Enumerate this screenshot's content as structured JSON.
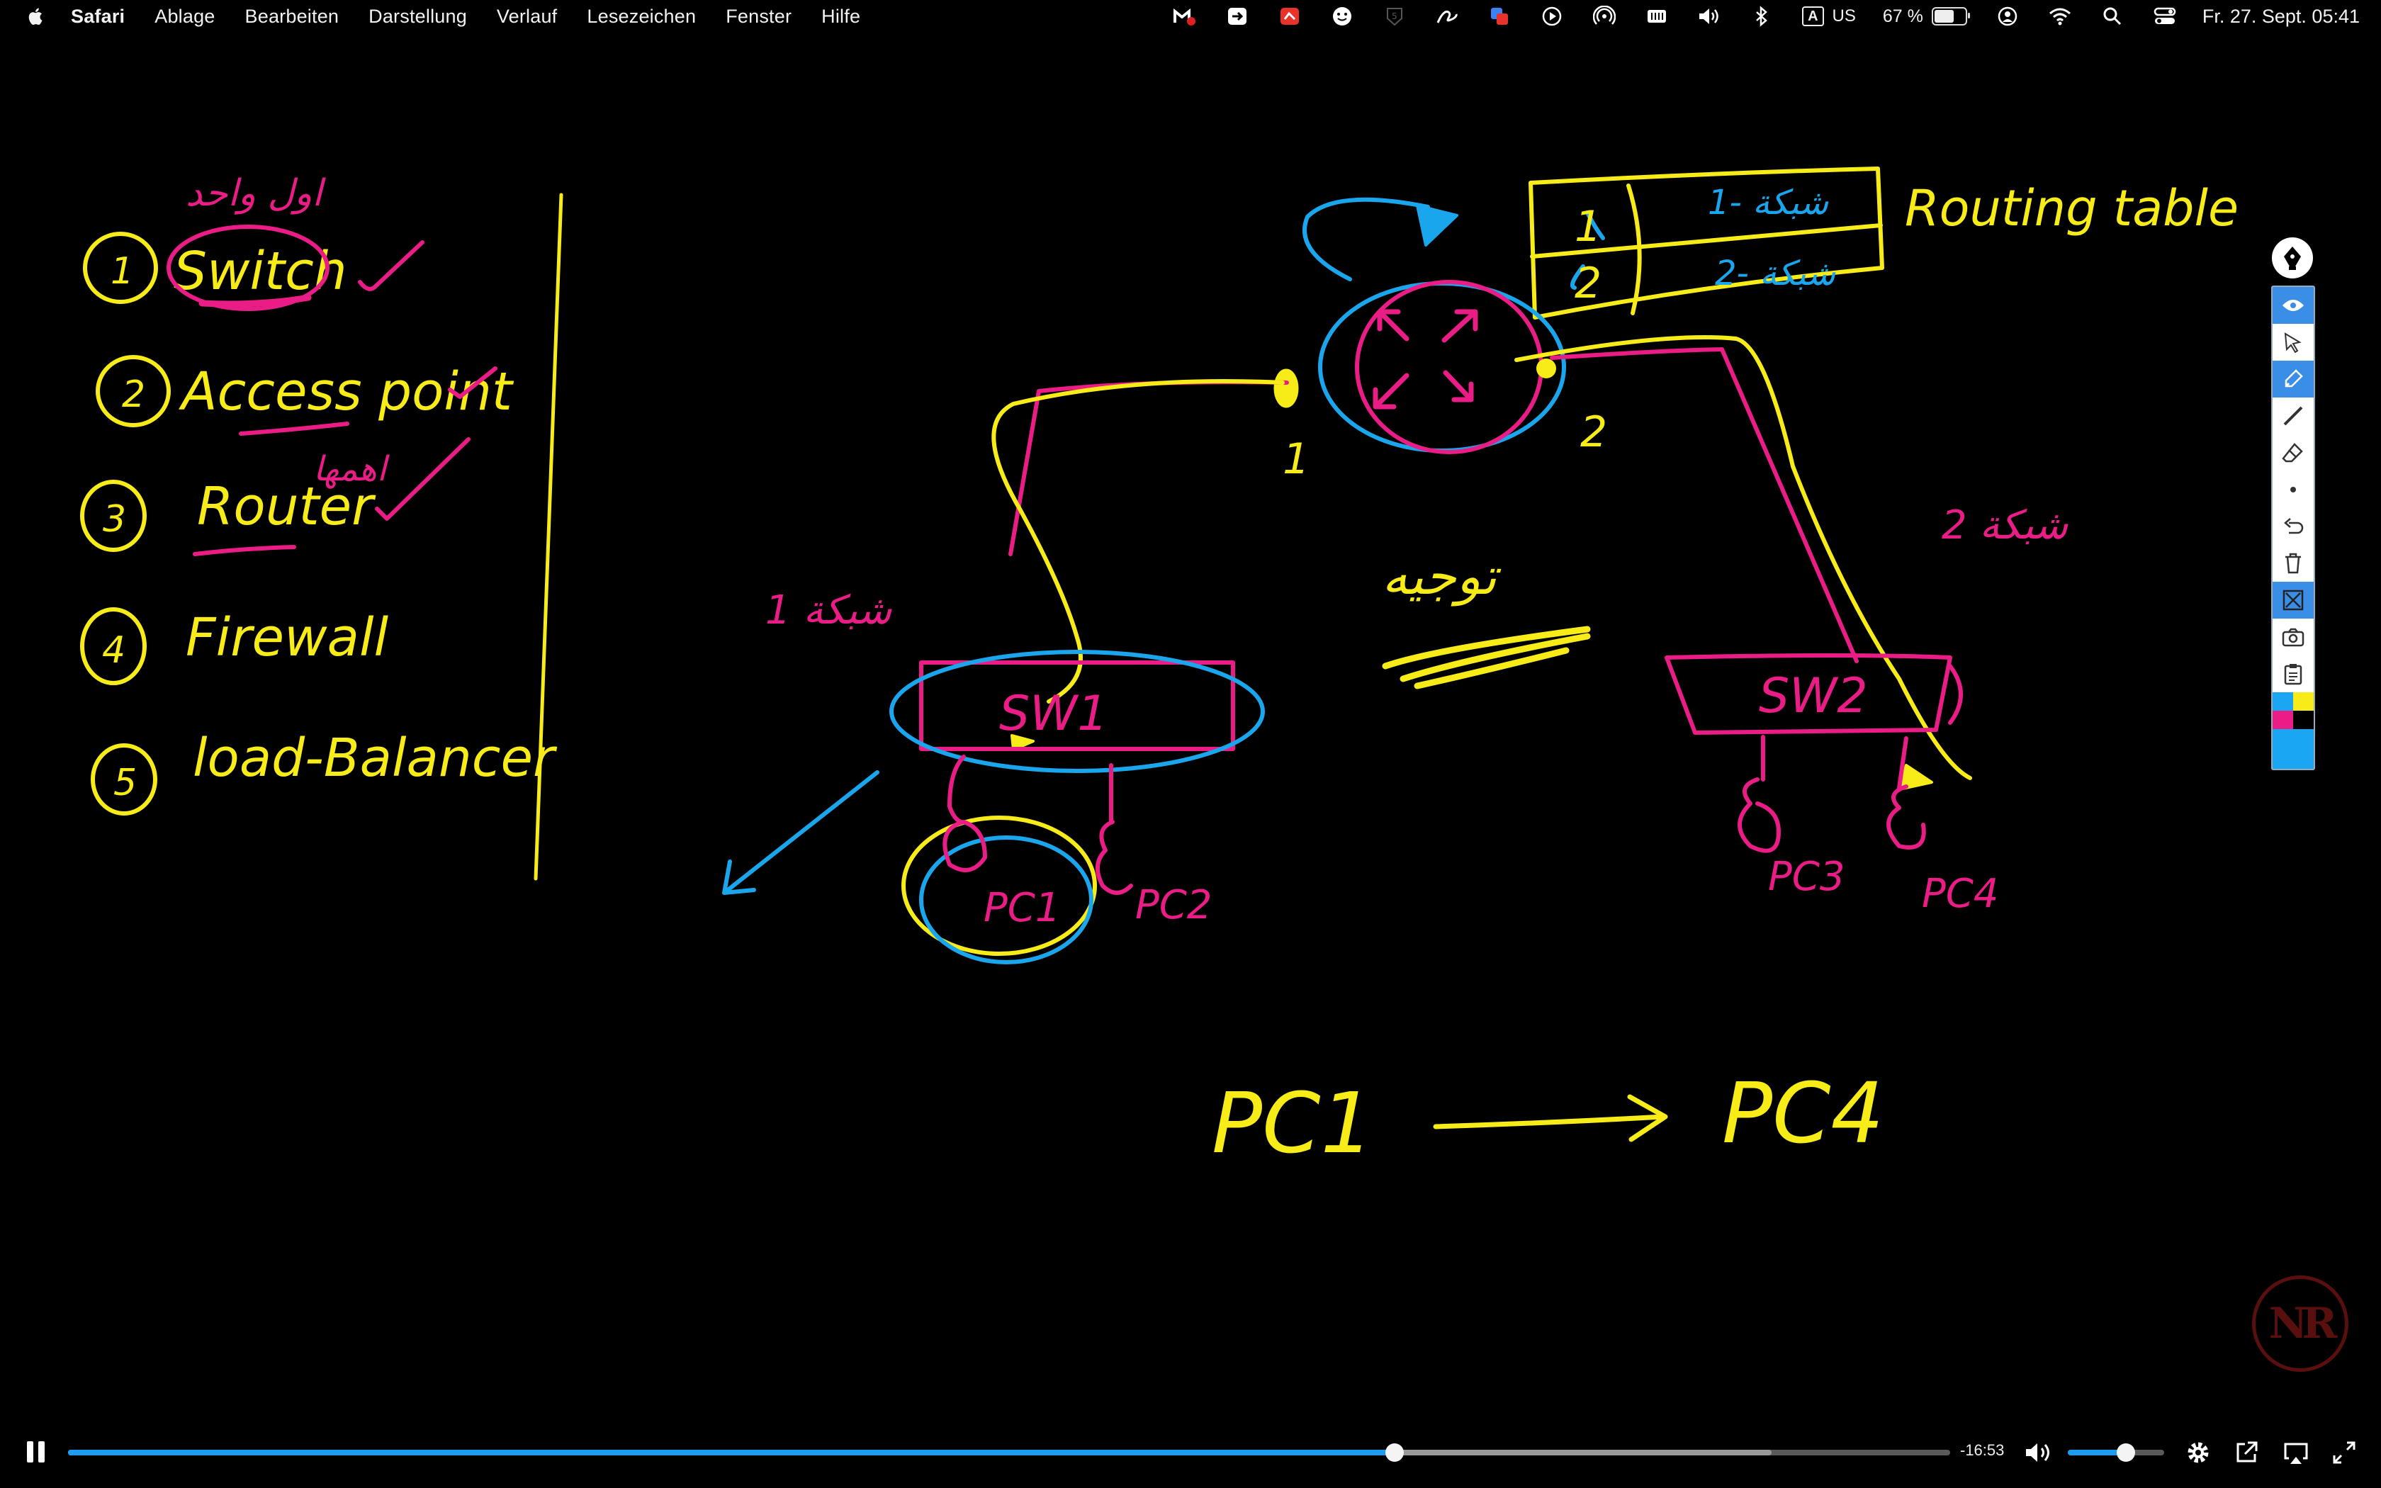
{
  "menubar": {
    "apple_icon": "apple-logo-icon",
    "items": [
      "Safari",
      "Ablage",
      "Bearbeiten",
      "Darstellung",
      "Verlauf",
      "Lesezeichen",
      "Fenster",
      "Hilfe"
    ],
    "status": {
      "input_source_letter": "A",
      "input_source": "US",
      "battery_percent": "67 %",
      "battery_level": 0.67,
      "clock": "Fr. 27. Sept. 05:41"
    }
  },
  "whiteboard": {
    "list": [
      {
        "num": "1",
        "text": "Switch"
      },
      {
        "num": "2",
        "text": "Access point"
      },
      {
        "num": "3",
        "text": "Router"
      },
      {
        "num": "4",
        "Firewall": null,
        "text": "Firewall"
      },
      {
        "num": "5",
        "text": "load-Balancer"
      }
    ],
    "arabic_note_switch": "اول واحد",
    "arabic_note_router": "اهمها",
    "routing_table_label": "Routing table",
    "routing_rows": [
      {
        "id": "1",
        "entry": "1- شبكة"
      },
      {
        "id": "2",
        "entry": "2- شبكة"
      }
    ],
    "router_port_1": "1",
    "router_port_2": "2",
    "network_1_label": "1 شبكة",
    "network_2_label": "2 شبكة",
    "center_note": "توجيه",
    "switch_1": "SW1",
    "switch_2": "SW2",
    "pc_1": "PC1",
    "pc_2": "PC2",
    "pc_3": "PC3",
    "pc_4": "PC4",
    "flow_from": "PC1",
    "flow_to": "PC4"
  },
  "colors": {
    "yellow": "#f7ec18",
    "pink": "#ea1c86",
    "blue": "#1aa6ec"
  },
  "toolbar": {
    "tools": [
      "pen-icon",
      "eye-icon",
      "cursor-icon",
      "highlighter-icon",
      "line-icon",
      "eraser-icon",
      "dot-icon",
      "undo-icon",
      "trash-icon",
      "clear-icon",
      "camera-icon",
      "clipboard-icon"
    ],
    "swatches": [
      "#1aa6f2",
      "#f7ec18",
      "#ea1c86",
      "#000000"
    ]
  },
  "player": {
    "time_remaining": "-16:53",
    "progress": 0.705,
    "buffered": 0.905,
    "volume": 0.6
  },
  "watermark": "NR"
}
